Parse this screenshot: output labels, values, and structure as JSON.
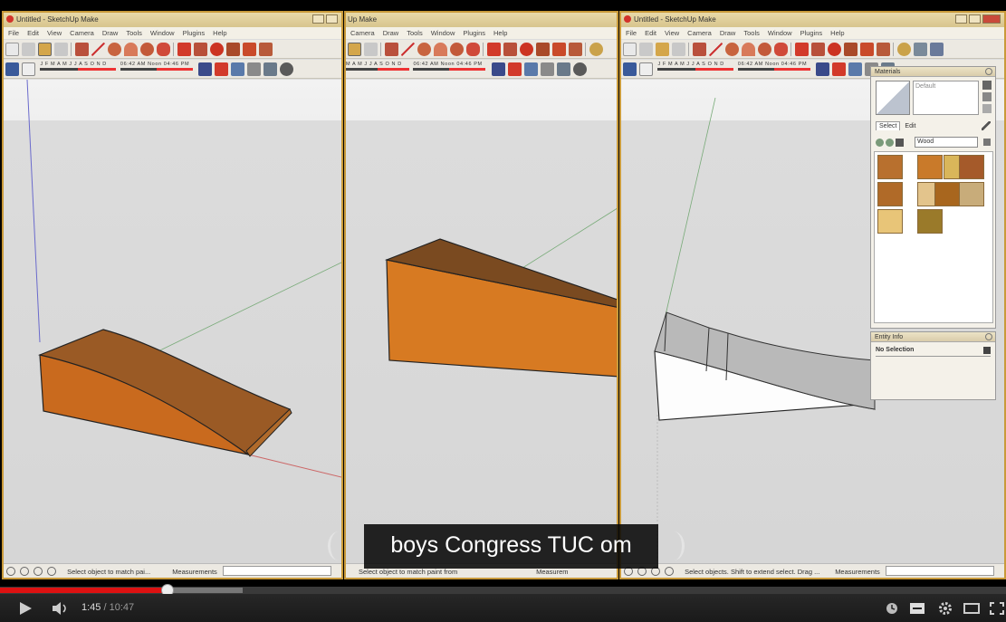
{
  "windows": [
    {
      "title": "Untitled - SketchUp Make",
      "menu": [
        "File",
        "Edit",
        "View",
        "Camera",
        "Draw",
        "Tools",
        "Window",
        "Plugins",
        "Help"
      ],
      "shadow_months": "J F M A M J J A S O N D",
      "time_left": "06:42 AM",
      "time_mid": "Noon",
      "time_right": "04:46 PM",
      "status_text": "Select object to match pai...",
      "measurements_label": "Measurements"
    },
    {
      "title": "Up Make",
      "menu": [
        "Camera",
        "Draw",
        "Tools",
        "Window",
        "Plugins",
        "Help"
      ],
      "shadow_months": "M A M J J A S O N D",
      "time_left": "06:42 AM",
      "time_mid": "Noon",
      "time_right": "04:46 PM",
      "status_text": "Select object to match paint from",
      "measurements_label": "Measurem"
    },
    {
      "title": "Untitled - SketchUp Make",
      "menu": [
        "File",
        "Edit",
        "View",
        "Camera",
        "Draw",
        "Tools",
        "Window",
        "Plugins",
        "Help"
      ],
      "shadow_months": "J F M A M J J A S O N D",
      "time_left": "06:42 AM",
      "time_mid": "Noon",
      "time_right": "04:46 PM",
      "status_text": "Select objects. Shift to extend select. Drag ...",
      "measurements_label": "Measurements"
    }
  ],
  "materials_panel": {
    "title": "Materials",
    "preview_name": "Default",
    "tabs": [
      "Select",
      "Edit"
    ],
    "library": "Wood",
    "swatch_colors": [
      "#b8702e",
      "#c97a2a",
      "#d9b65a",
      "#a55a2a",
      "#b06a28",
      "#e3c48c",
      "#a8661e",
      "#c8ac7a",
      "#e8c578",
      "#9a7a2a"
    ]
  },
  "entity_panel": {
    "title": "Entity Info",
    "selection": "No Selection"
  },
  "caption": "boys Congress TUC om",
  "player": {
    "current_time": "1:45",
    "separator": "/",
    "duration": "10:47",
    "progress_fraction": 0.1669,
    "buffered_fraction": 0.241,
    "accent": "#dd1111"
  }
}
